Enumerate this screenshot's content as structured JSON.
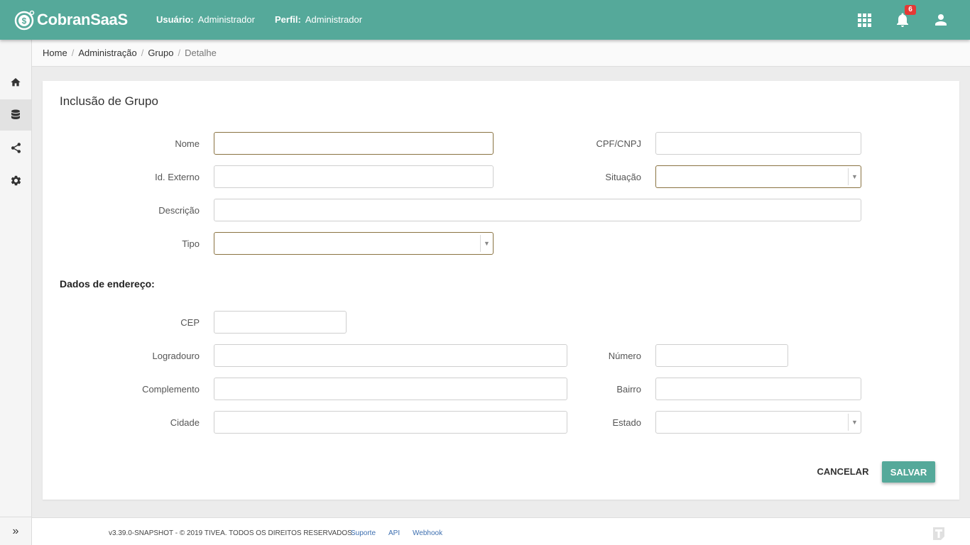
{
  "app": {
    "name": "CobranSaaS",
    "accent_color": "#55a99a",
    "notification_badge_color": "#e53935"
  },
  "header": {
    "user_label": "Usuário:",
    "user_value": "Administrador",
    "profile_label": "Perfil:",
    "profile_value": "Administrador",
    "notification_count": "6",
    "icons": [
      "apps-grid-icon",
      "bell-icon",
      "account-icon"
    ]
  },
  "sidebar": {
    "items": [
      {
        "name": "home",
        "icon": "home-icon",
        "active": false
      },
      {
        "name": "database",
        "icon": "database-icon",
        "active": true
      },
      {
        "name": "share",
        "icon": "share-icon",
        "active": false
      },
      {
        "name": "settings",
        "icon": "gear-icon",
        "active": false
      }
    ],
    "expand_label": "»"
  },
  "breadcrumb": {
    "items": [
      "Home",
      "Administração",
      "Grupo"
    ],
    "current": "Detalhe",
    "separator": "/"
  },
  "form": {
    "title": "Inclusão de Grupo",
    "fields": {
      "nome": {
        "label": "Nome",
        "value": ""
      },
      "cpf_cnpj": {
        "label": "CPF/CNPJ",
        "value": ""
      },
      "id_externo": {
        "label": "Id. Externo",
        "value": ""
      },
      "situacao": {
        "label": "Situação",
        "value": ""
      },
      "descricao": {
        "label": "Descrição",
        "value": ""
      },
      "tipo": {
        "label": "Tipo",
        "value": ""
      }
    },
    "address_title": "Dados de endereço:",
    "address": {
      "cep": {
        "label": "CEP",
        "value": ""
      },
      "logradouro": {
        "label": "Logradouro",
        "value": ""
      },
      "numero": {
        "label": "Número",
        "value": ""
      },
      "complemento": {
        "label": "Complemento",
        "value": ""
      },
      "bairro": {
        "label": "Bairro",
        "value": ""
      },
      "cidade": {
        "label": "Cidade",
        "value": ""
      },
      "estado": {
        "label": "Estado",
        "value": ""
      }
    },
    "cancel_label": "CANCELAR",
    "save_label": "SALVAR"
  },
  "footer": {
    "copyright": "v3.39.0-SNAPSHOT - © 2019 TIVEA. TODOS OS DIREITOS RESERVADOS.",
    "links": [
      "Suporte",
      "API",
      "Webhook"
    ]
  }
}
